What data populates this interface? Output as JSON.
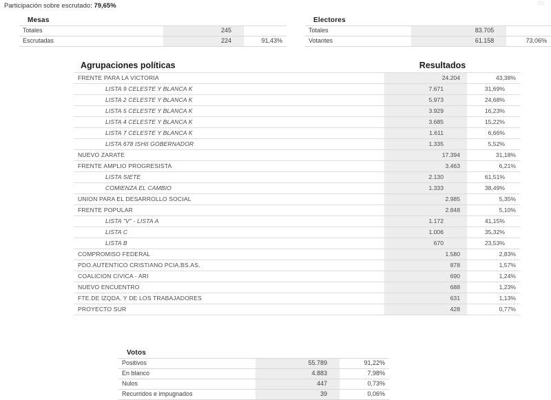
{
  "participation": {
    "label": "Participación sobre escrutado:",
    "value": "79,65%"
  },
  "mesas": {
    "title": "Mesas",
    "rows": [
      {
        "label": "Totales",
        "value": "245",
        "percent": ""
      },
      {
        "label": "Escrutadas",
        "value": "224",
        "percent": "91,43%"
      }
    ]
  },
  "electores": {
    "title": "Electores",
    "rows": [
      {
        "label": "Totales",
        "value": "83.705",
        "percent": ""
      },
      {
        "label": "Votantes",
        "value": "61.158",
        "percent": "73,06%"
      }
    ]
  },
  "results": {
    "header_left": "Agrupaciones políticas",
    "header_right": "Resultados",
    "rows": [
      {
        "type": "party",
        "name": "FRENTE PARA LA VICTORIA",
        "votes": "24.204",
        "share": "43,38%"
      },
      {
        "type": "list",
        "name": "LISTA 9 CELESTE Y BLANCA K",
        "votes": "7.671",
        "share": "31,69%"
      },
      {
        "type": "list",
        "name": "LISTA 2 CELESTE Y BLANCA K",
        "votes": "5.973",
        "share": "24,68%"
      },
      {
        "type": "list",
        "name": "LISTA 5 CELESTE Y BLANCA K",
        "votes": "3.929",
        "share": "16,23%"
      },
      {
        "type": "list",
        "name": "LISTA 4 CELESTE Y BLANCA K",
        "votes": "3.685",
        "share": "15,22%"
      },
      {
        "type": "list",
        "name": "LISTA 7 CELESTE Y BLANCA K",
        "votes": "1.611",
        "share": "6,66%"
      },
      {
        "type": "list",
        "name": "LISTA 678 ISHII GOBERNADOR",
        "votes": "1.335",
        "share": "5,52%"
      },
      {
        "type": "party",
        "name": "NUEVO ZARATE",
        "votes": "17.394",
        "share": "31,18%"
      },
      {
        "type": "party",
        "name": "FRENTE AMPLIO PROGRESISTA",
        "votes": "3.463",
        "share": "6,21%"
      },
      {
        "type": "list",
        "name": "LISTA SIETE",
        "votes": "2.130",
        "share": "61,51%"
      },
      {
        "type": "list",
        "name": "COMIENZA EL CAMBIO",
        "votes": "1.333",
        "share": "38,49%"
      },
      {
        "type": "party",
        "name": "UNION PARA EL DESARROLLO SOCIAL",
        "votes": "2.985",
        "share": "5,35%"
      },
      {
        "type": "party",
        "name": "FRENTE POPULAR",
        "votes": "2.848",
        "share": "5,10%"
      },
      {
        "type": "list",
        "name": "LISTA \"V\" - LISTA A",
        "votes": "1.172",
        "share": "41,15%"
      },
      {
        "type": "list",
        "name": "LISTA C",
        "votes": "1.006",
        "share": "35,32%"
      },
      {
        "type": "list",
        "name": "LISTA B",
        "votes": "670",
        "share": "23,53%"
      },
      {
        "type": "party",
        "name": "COMPROMISO FEDERAL",
        "votes": "1.580",
        "share": "2,83%"
      },
      {
        "type": "party",
        "name": "PDO.AUTENTICO CRISTIANO PCIA.BS.AS.",
        "votes": "878",
        "share": "1,57%"
      },
      {
        "type": "party",
        "name": "COALICION CIVICA - ARI",
        "votes": "690",
        "share": "1,24%"
      },
      {
        "type": "party",
        "name": "NUEVO ENCUENTRO",
        "votes": "688",
        "share": "1,23%"
      },
      {
        "type": "party",
        "name": "FTE.DE IZQDA. Y DE LOS TRABAJADORES",
        "votes": "631",
        "share": "1,13%"
      },
      {
        "type": "party",
        "name": "PROYECTO SUR",
        "votes": "428",
        "share": "0,77%"
      }
    ]
  },
  "votos": {
    "title": "Votos",
    "rows": [
      {
        "label": "Positivos",
        "value": "55.789",
        "percent": "91,22%"
      },
      {
        "label": "En blanco",
        "value": "4.883",
        "percent": "7,98%"
      },
      {
        "label": "Nulos",
        "value": "447",
        "percent": "0,73%"
      },
      {
        "label": "Recurridos e impugnados",
        "value": "39",
        "percent": "0,06%"
      }
    ]
  }
}
